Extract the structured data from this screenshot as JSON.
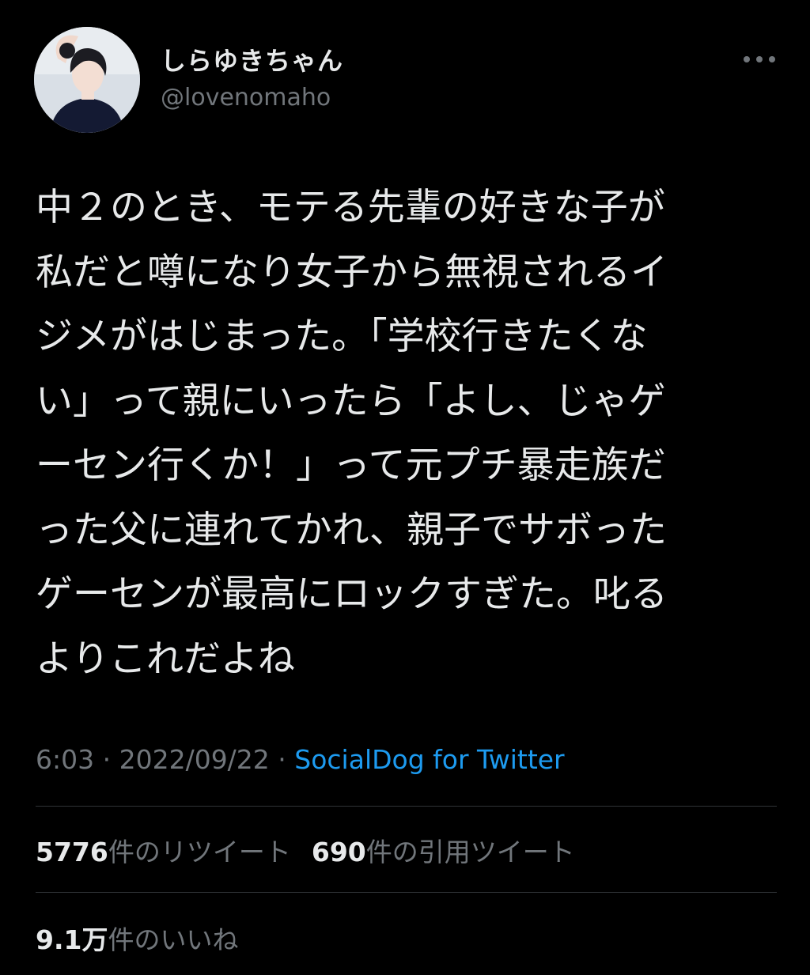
{
  "user": {
    "display_name": "しらゆきちゃん",
    "handle": "@lovenomaho",
    "avatar": "profile-photo"
  },
  "more_icon": "ellipsis-icon",
  "tweet": {
    "lines": [
      "中２のとき、モテる先輩の好きな子が",
      "私だと噂になり女子から無視されるイ",
      "ジメがはじまった。「学校行きたくな",
      "い」って親にいったら「よし、じゃゲ",
      "ーセン行くか！」って元プチ暴走族だ",
      "った父に連れてかれ、親子でサボった",
      "ゲーセンが最高にロックすぎた。叱る",
      "よりこれだよね"
    ]
  },
  "meta": {
    "time": "6:03",
    "date": "2022/09/22",
    "separator": " · ",
    "source": "SocialDog for Twitter"
  },
  "stats": {
    "retweets_count": "5776",
    "retweets_label": "件のリツイート",
    "quotes_count": "690",
    "quotes_label": "件の引用ツイート",
    "likes_count": "9.1万",
    "likes_label": "件のいいね"
  },
  "colors": {
    "background": "#000000",
    "text": "#e7e9ea",
    "secondary": "#71767b",
    "link": "#1d9bf0",
    "divider": "#2f3336"
  }
}
